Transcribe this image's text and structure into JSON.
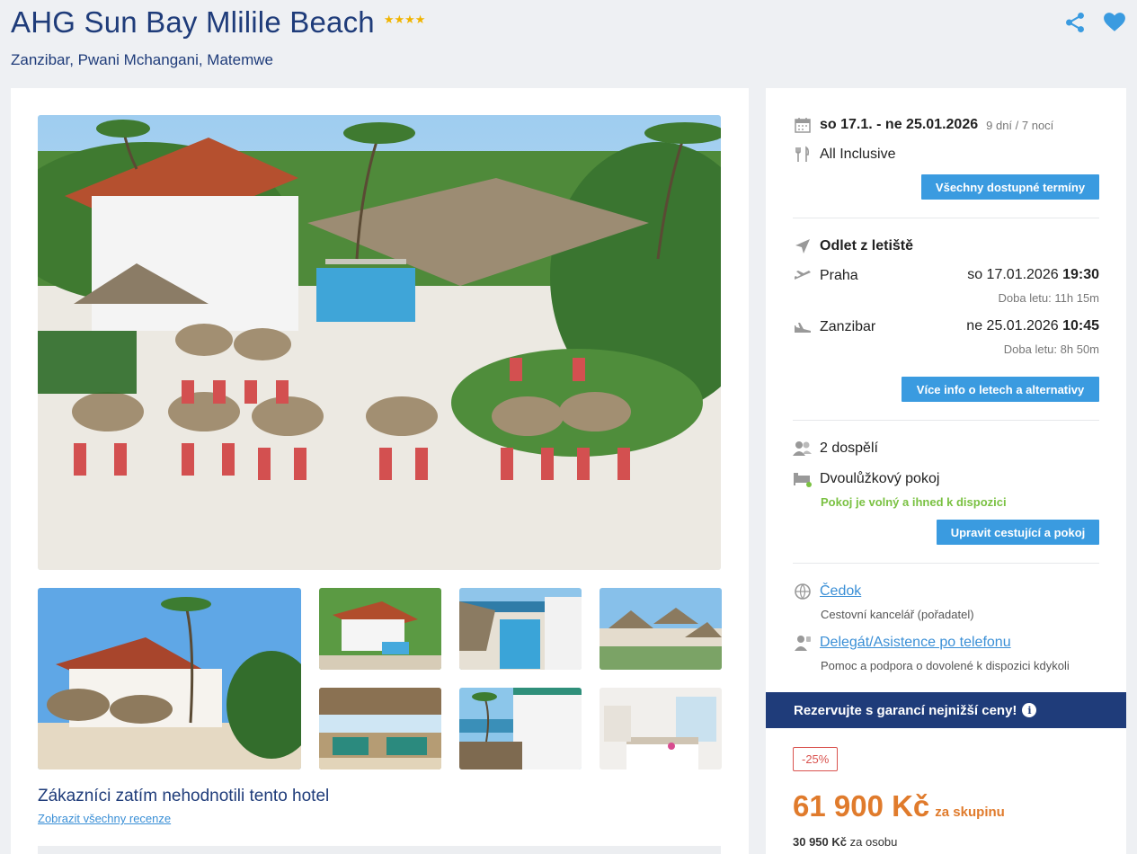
{
  "hotel": {
    "name": "AHG Sun Bay Mlilile Beach",
    "stars": "★★★★",
    "location": "Zanzibar, Pwani Mchangani, Matemwe"
  },
  "icons": {
    "share": "share-icon",
    "favorite": "heart-icon"
  },
  "reviews": {
    "title": "Zákazníci zatím nehodnotili tento hotel",
    "link": "Zobrazit všechny recenze"
  },
  "trip": {
    "dates": "so 17.1. - ne 25.01.2026",
    "duration": "9 dní / 7 nocí",
    "board": "All Inclusive",
    "dates_button": "Všechny dostupné termíny"
  },
  "flights": {
    "heading": "Odlet z letiště",
    "outbound": {
      "city": "Praha",
      "date": "so 17.01.2026",
      "time": "19:30",
      "duration": "Doba letu: 11h 15m"
    },
    "inbound": {
      "city": "Zanzibar",
      "date": "ne 25.01.2026",
      "time": "10:45",
      "duration": "Doba letu: 8h 50m"
    },
    "button": "Více info o letech a alternativy"
  },
  "travelers": {
    "count": "2 dospělí",
    "room": "Dvoulůžkový pokoj",
    "availability": "Pokoj je volný a ihned k dispozici",
    "button": "Upravit cestující a pokoj"
  },
  "organizer": {
    "name": "Čedok",
    "desc": "Cestovní kancelář (pořadatel)",
    "assist": "Delegát/Asistence po telefonu",
    "assist_desc": "Pomoc a podpora o dovolené k dispozici kdykoli"
  },
  "booking": {
    "banner": "Rezervujte s garancí nejnižší ceny!",
    "discount": "-25%",
    "price": "61 900 Kč",
    "price_suffix": "za skupinu",
    "per_person_price": "30 950 Kč",
    "per_person_label": "za osobu"
  },
  "colors": {
    "accent": "#3a9be0",
    "brand": "#1f3c7a",
    "price": "#e07b2c",
    "available": "#7ac142"
  }
}
